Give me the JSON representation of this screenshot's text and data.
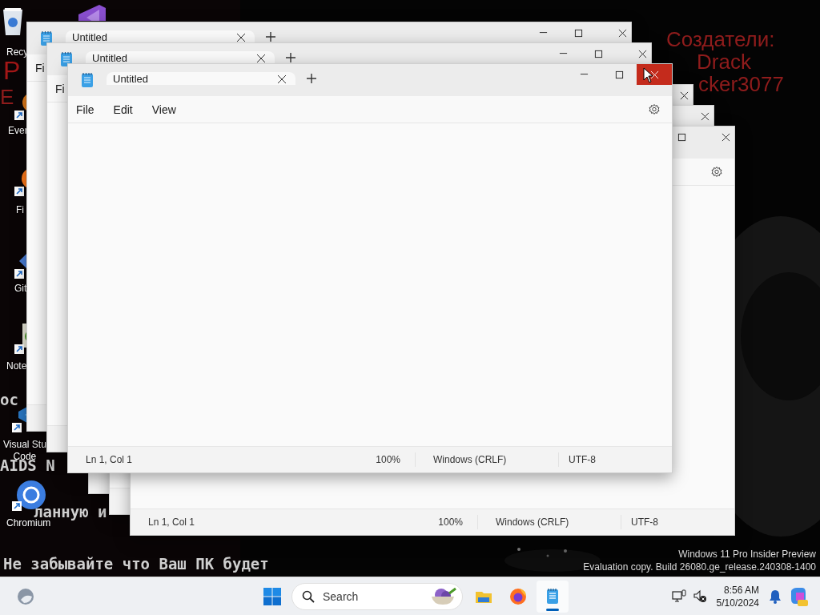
{
  "desktop": {
    "wallpaper_texts": [
      {
        "kind": "red",
        "text": "Р"
      },
      {
        "kind": "red",
        "text": "Е"
      },
      {
        "kind": "red",
        "text": "Создатели:"
      },
      {
        "kind": "red",
        "text": "Drack"
      },
      {
        "kind": "red",
        "text": "cker3077"
      },
      {
        "kind": "mono",
        "text": "ос"
      },
      {
        "kind": "mono",
        "text": "AIDS N"
      },
      {
        "kind": "mono",
        "text": "ланную и"
      },
      {
        "kind": "mono",
        "text": "Не забывайте что Ваш ПК будет"
      }
    ],
    "icons": [
      {
        "kind": "recycle-bin",
        "label": "Recy"
      },
      {
        "kind": "visual-studio"
      },
      {
        "kind": "everything",
        "label": "Ever"
      },
      {
        "kind": "firefox",
        "label": "Fi"
      },
      {
        "kind": "git",
        "label": "Git"
      },
      {
        "kind": "notepad-plus",
        "label": "Note"
      },
      {
        "kind": "vscode",
        "label": "Visual Stu\nCode"
      },
      {
        "kind": "chromium",
        "label": "Chromium"
      }
    ],
    "watermark": [
      "Windows 11 Pro Insider Preview",
      "Evaluation copy. Build 26080.ge_release.240308-1400"
    ]
  },
  "windows": [
    {
      "tab": "Untitled",
      "controls": [
        {
          "kind": "minimize"
        },
        {
          "kind": "maximize"
        },
        {
          "kind": "close"
        }
      ],
      "menu": {
        "items": [
          "Fi"
        ]
      }
    },
    {
      "tab": "Untitled",
      "controls": [
        {
          "kind": "minimize"
        },
        {
          "kind": "maximize"
        },
        {
          "kind": "close"
        }
      ],
      "menu": {
        "items": [
          "Fi"
        ]
      }
    },
    {
      "controls": [
        {
          "kind": "close"
        }
      ]
    },
    {
      "controls": [
        {
          "kind": "close"
        }
      ]
    },
    {
      "controls": [
        {
          "kind": "maximize"
        },
        {
          "kind": "close"
        }
      ],
      "menu": {
        "settings": true
      },
      "status": [
        "Ln 1, Col 1",
        "100%",
        "Windows (CRLF)",
        "UTF-8"
      ]
    },
    {
      "tab": "Untitled",
      "controls": [
        {
          "kind": "minimize"
        },
        {
          "kind": "maximize"
        },
        {
          "kind": "close",
          "hovered": true
        }
      ],
      "menu": {
        "items": [
          "File",
          "Edit",
          "View"
        ],
        "settings": true
      },
      "status": [
        "Ln 1, Col 1",
        "100%",
        "Windows (CRLF)",
        "UTF-8"
      ]
    }
  ],
  "taskbar": {
    "search": {
      "placeholder": "Search"
    },
    "apps": [
      {
        "kind": "explorer",
        "selected": false
      },
      {
        "kind": "firefox",
        "selected": false
      },
      {
        "kind": "notepad",
        "selected": true
      }
    ],
    "clock": {
      "time": "8:56 AM",
      "date": "5/10/2024"
    }
  }
}
